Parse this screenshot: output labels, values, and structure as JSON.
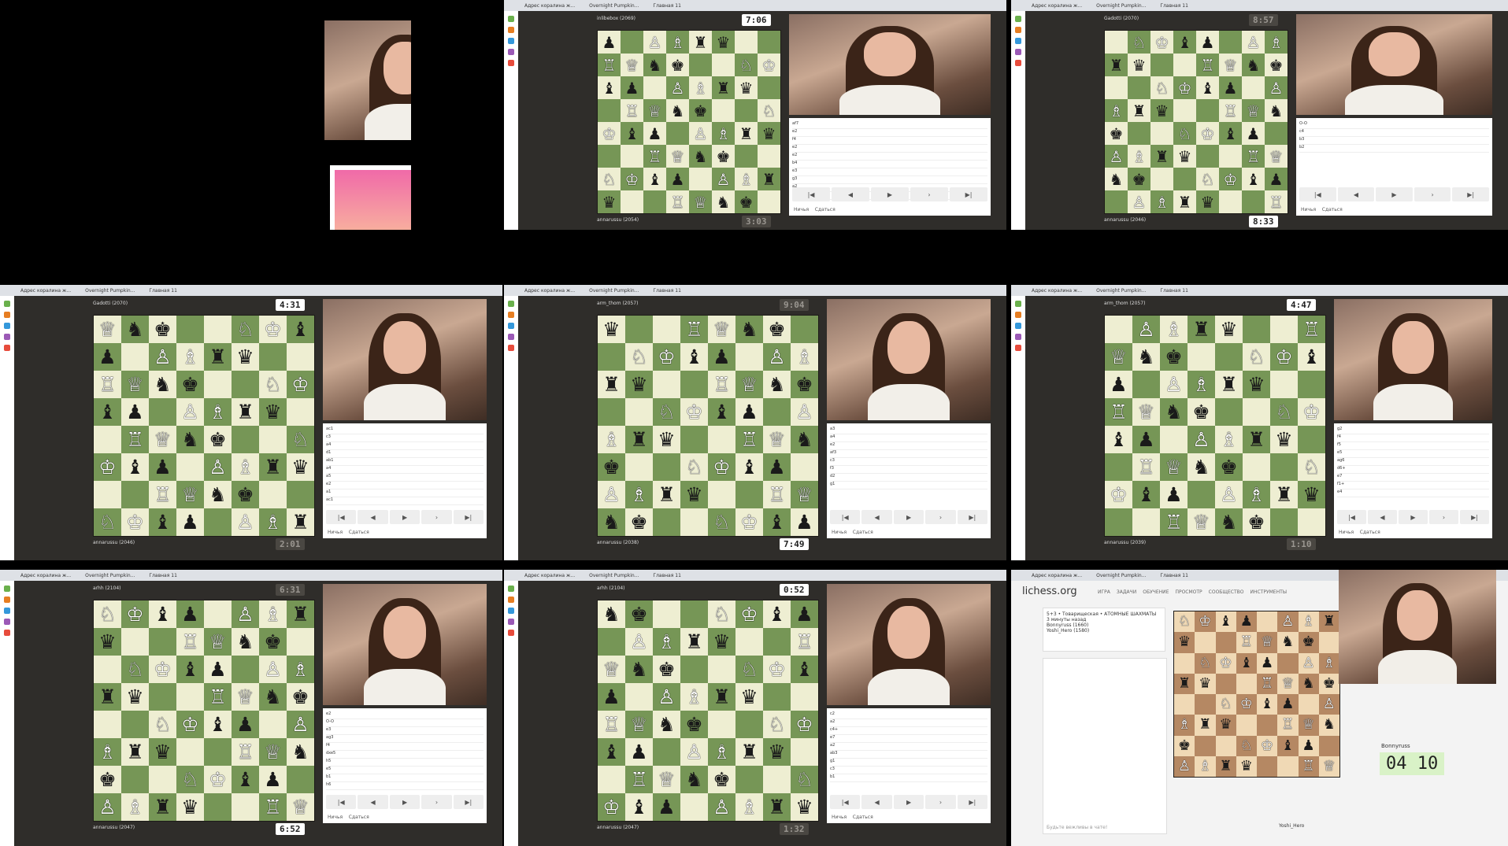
{
  "tiles": [
    {
      "id": "t0"
    },
    {
      "id": "t1",
      "top_player": "inlibebox (2069)",
      "bottom_player": "annarussu (2054)",
      "top_clock": "7:06",
      "bottom_clock": "3:03",
      "moves": [
        "af7",
        "e2",
        "f4",
        "e2",
        "e2",
        "b4",
        "e3",
        "g3",
        "a2",
        "af1"
      ],
      "links": [
        "Ничья",
        "Сдаться"
      ]
    },
    {
      "id": "t2",
      "top_player": "Gadotti (2070)",
      "bottom_player": "annarussu (2046)",
      "top_clock": "8:57",
      "bottom_clock": "8:33",
      "moves": [
        "O-O",
        "c4",
        "b3",
        "b2"
      ],
      "links": [
        "Ничья",
        "Сдаться"
      ]
    },
    {
      "id": "t3",
      "top_player": "Gadotti (2070)",
      "bottom_player": "annarussu (2046)",
      "top_clock": "4:31",
      "bottom_clock": "2:01",
      "moves": [
        "ac1",
        "c3",
        "a4",
        "d1",
        "ab1",
        "a4",
        "a5",
        "e2",
        "a1",
        "ac1"
      ],
      "links": [
        "Ничья",
        "Сдаться"
      ]
    },
    {
      "id": "t4",
      "top_player": "arm_thom (2057)",
      "bottom_player": "annarussu (2038)",
      "top_clock": "9:04",
      "bottom_clock": "7:49",
      "moves": [
        "a3",
        "a4",
        "e2",
        "af3",
        "c3",
        "f3",
        "d2",
        "g1"
      ],
      "links": [
        "Ничья",
        "Сдаться"
      ]
    },
    {
      "id": "t5",
      "top_player": "arm_thom (2057)",
      "bottom_player": "annarussu (2039)",
      "top_clock": "4:47",
      "bottom_clock": "1:10",
      "moves": [
        "g2",
        "f4",
        "f5",
        "e5",
        "ag6",
        "d6+",
        "e7",
        "f1+",
        "e4"
      ],
      "links": [
        "Ничья",
        "Сдаться"
      ]
    },
    {
      "id": "t6",
      "top_player": "arhh (2104)",
      "bottom_player": "annarussu (2047)",
      "top_clock": "6:31",
      "bottom_clock": "6:52",
      "moves": [
        "e2",
        "O-O",
        "e3",
        "ag3",
        "f4",
        "dxe5",
        "h5",
        "e5",
        "b1",
        "h6"
      ],
      "links": [
        "Ничья",
        "Сдаться"
      ]
    },
    {
      "id": "t7",
      "top_player": "arhh (2104)",
      "bottom_player": "annarussu (2047)",
      "top_clock": "0:52",
      "bottom_clock": "1:32",
      "moves": [
        "c2",
        "a2",
        "c4+",
        "e7",
        "a2",
        "ab3",
        "g1",
        "c3",
        "b1"
      ],
      "links": [
        "Ничья",
        "Сдаться"
      ]
    },
    {
      "id": "t8",
      "site": "lichess.org",
      "nav": [
        "ИГРА",
        "ЗАДАЧИ",
        "ОБУЧЕНИЕ",
        "ПРОСМОТР",
        "СООБЩЕСТВО",
        "ИНСТРУМЕНТЫ"
      ],
      "game_title": "5+3 • Товарищеская • АТОМНЫЕ ШАХМАТЫ",
      "game_sub": "3 минуты назад",
      "player1": "Bonnyruss (1660)",
      "player2": "Yoshi_Hero (1580)",
      "chat_placeholder": "Будьте вежливы в чате!",
      "clock": "04 10",
      "player_name": "Bonnyruss",
      "opponent": "Yoshi_Hero"
    }
  ],
  "browser_tabs": [
    "Адрес коралина ж...",
    "Overnight Pumpkin...",
    "Главная 11"
  ]
}
